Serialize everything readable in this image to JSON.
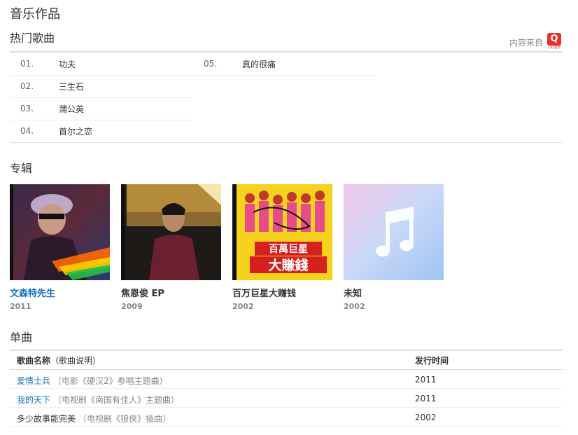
{
  "page": {
    "title": "音乐作品"
  },
  "source": {
    "label": "内容来自",
    "logo_letter": "Q",
    "logo_caption": "QQ音乐"
  },
  "hot_songs": {
    "title": "热门歌曲",
    "left": [
      {
        "num": "01.",
        "name": "功夫"
      },
      {
        "num": "02.",
        "name": "三生石"
      },
      {
        "num": "03.",
        "name": "蒲公英"
      },
      {
        "num": "04.",
        "name": "首尔之恋"
      }
    ],
    "right": [
      {
        "num": "05.",
        "name": "真的很痛"
      }
    ]
  },
  "albums": {
    "title": "专辑",
    "items": [
      {
        "name": "文森特先生",
        "year": "2011"
      },
      {
        "name": "焦恩俊 EP",
        "year": "2009"
      },
      {
        "name": "百万巨星大赚钱",
        "year": "2002",
        "cover_text_1": "百萬巨星",
        "cover_text_2": "大賺錢"
      },
      {
        "name": "未知",
        "year": "2002"
      }
    ]
  },
  "singles": {
    "title": "单曲",
    "header": {
      "name": "歌曲名称",
      "desc": "（歌曲说明）",
      "date": "发行时间"
    },
    "rows": [
      {
        "name": "爱情士兵",
        "desc": "（电影《硬汉2》参唱主题曲）",
        "date": "2011"
      },
      {
        "name": "我的天下",
        "desc": "（电视剧《南国有佳人》主题曲）",
        "date": "2011"
      },
      {
        "name": "多少故事能完美",
        "desc": "（电视剧《狼侠》插曲）",
        "date": "2002"
      }
    ]
  },
  "colors": {
    "link": "#136ec2",
    "brand_red": "#e8302f"
  }
}
